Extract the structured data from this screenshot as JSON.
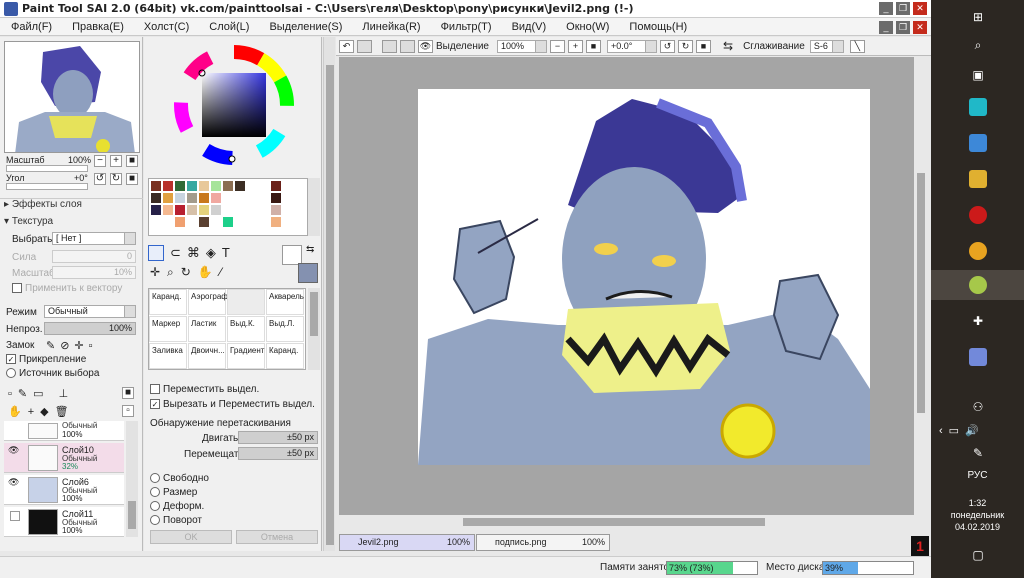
{
  "window": {
    "title": "Paint Tool SAI 2.0 (64bit) vk.com/painttoolsai - C:\\Users\\геля\\Desktop\\pony\\рисунки\\Jevil2.png (!-)"
  },
  "menu": [
    "Файл(F)",
    "Правка(E)",
    "Холст(C)",
    "Слой(L)",
    "Выделение(S)",
    "Линейка(R)",
    "Фильтр(T)",
    "Вид(V)",
    "Окно(W)",
    "Помощь(H)"
  ],
  "navigator": {
    "scale_label": "Масштаб",
    "scale_value": "100%",
    "angle_label": "Угол",
    "angle_value": "+0°"
  },
  "layer_effects": {
    "label": "Эффекты слоя"
  },
  "texture": {
    "header": "Текстура",
    "select_label": "Выбрать",
    "select_value": "[ Нет ]",
    "strength_label": "Сила",
    "strength_value": "0",
    "scale_label": "Масштаб",
    "scale_value": "10%",
    "apply_vector_label": "Применить к вектору"
  },
  "blend": {
    "mode_label": "Режим",
    "mode_value": "Обычный",
    "opacity_label": "Непроз.",
    "opacity_value": "100%",
    "lock_label": "Замок"
  },
  "clip": {
    "label": "Прикрепление",
    "source_label": "Источник выбора"
  },
  "layers": [
    {
      "name": "",
      "mode": "Обычный",
      "opacity": "100%"
    },
    {
      "name": "Слой10",
      "mode": "Обычный",
      "opacity": "32%"
    },
    {
      "name": "Слой6",
      "mode": "Обычный",
      "opacity": "100%"
    },
    {
      "name": "Слой11",
      "mode": "Обычный",
      "opacity": "100%"
    }
  ],
  "tools": [
    [
      "Каранд.",
      "Аэрограф",
      "",
      "Акварель"
    ],
    [
      "Маркер",
      "Ластик",
      "Выд.К.",
      "Выд.Л."
    ],
    [
      "Заливка",
      "Двоичн...",
      "Градиент",
      "Каранд."
    ]
  ],
  "selection_options": {
    "move_label": "Переместить выдел.",
    "cut_move_label": "Вырезать и Переместить выдел."
  },
  "drag_detection": {
    "header": "Обнаружение перетаскивания",
    "move_label": "Двигать",
    "move_value": "±50 px",
    "shift_label": "Перемещать",
    "shift_value": "±50 px"
  },
  "transform": {
    "options": [
      "Свободно",
      "Размер",
      "Деформ.",
      "Поворот"
    ],
    "ok_label": "OK",
    "cancel_label": "Отмена"
  },
  "canvas_toolbar": {
    "selection_label": "Выделение",
    "zoom_value": "100%",
    "angle_value": "+0.0°",
    "smoothing_label": "Сглаживание",
    "smoothing_value": "S-6"
  },
  "file_tabs": [
    {
      "name": "Jevil2.png",
      "percent": "100%"
    },
    {
      "name": "подпись.png",
      "percent": "100%"
    }
  ],
  "status": {
    "memory_label": "Памяти занято",
    "memory_value": "73% (73%)",
    "memory_fraction": 0.73,
    "disk_label": "Место диска",
    "disk_value": "39%",
    "disk_fraction": 0.39
  },
  "taskbar": {
    "lang": "РУС",
    "time": "1:32",
    "day": "понедельник",
    "date": "04.02.2019"
  },
  "colors": {
    "accent": "#3c3cc8",
    "memory_fill": "#58d68d",
    "disk_fill": "#5fa8e8",
    "layer_selected": "#f3dce9"
  }
}
